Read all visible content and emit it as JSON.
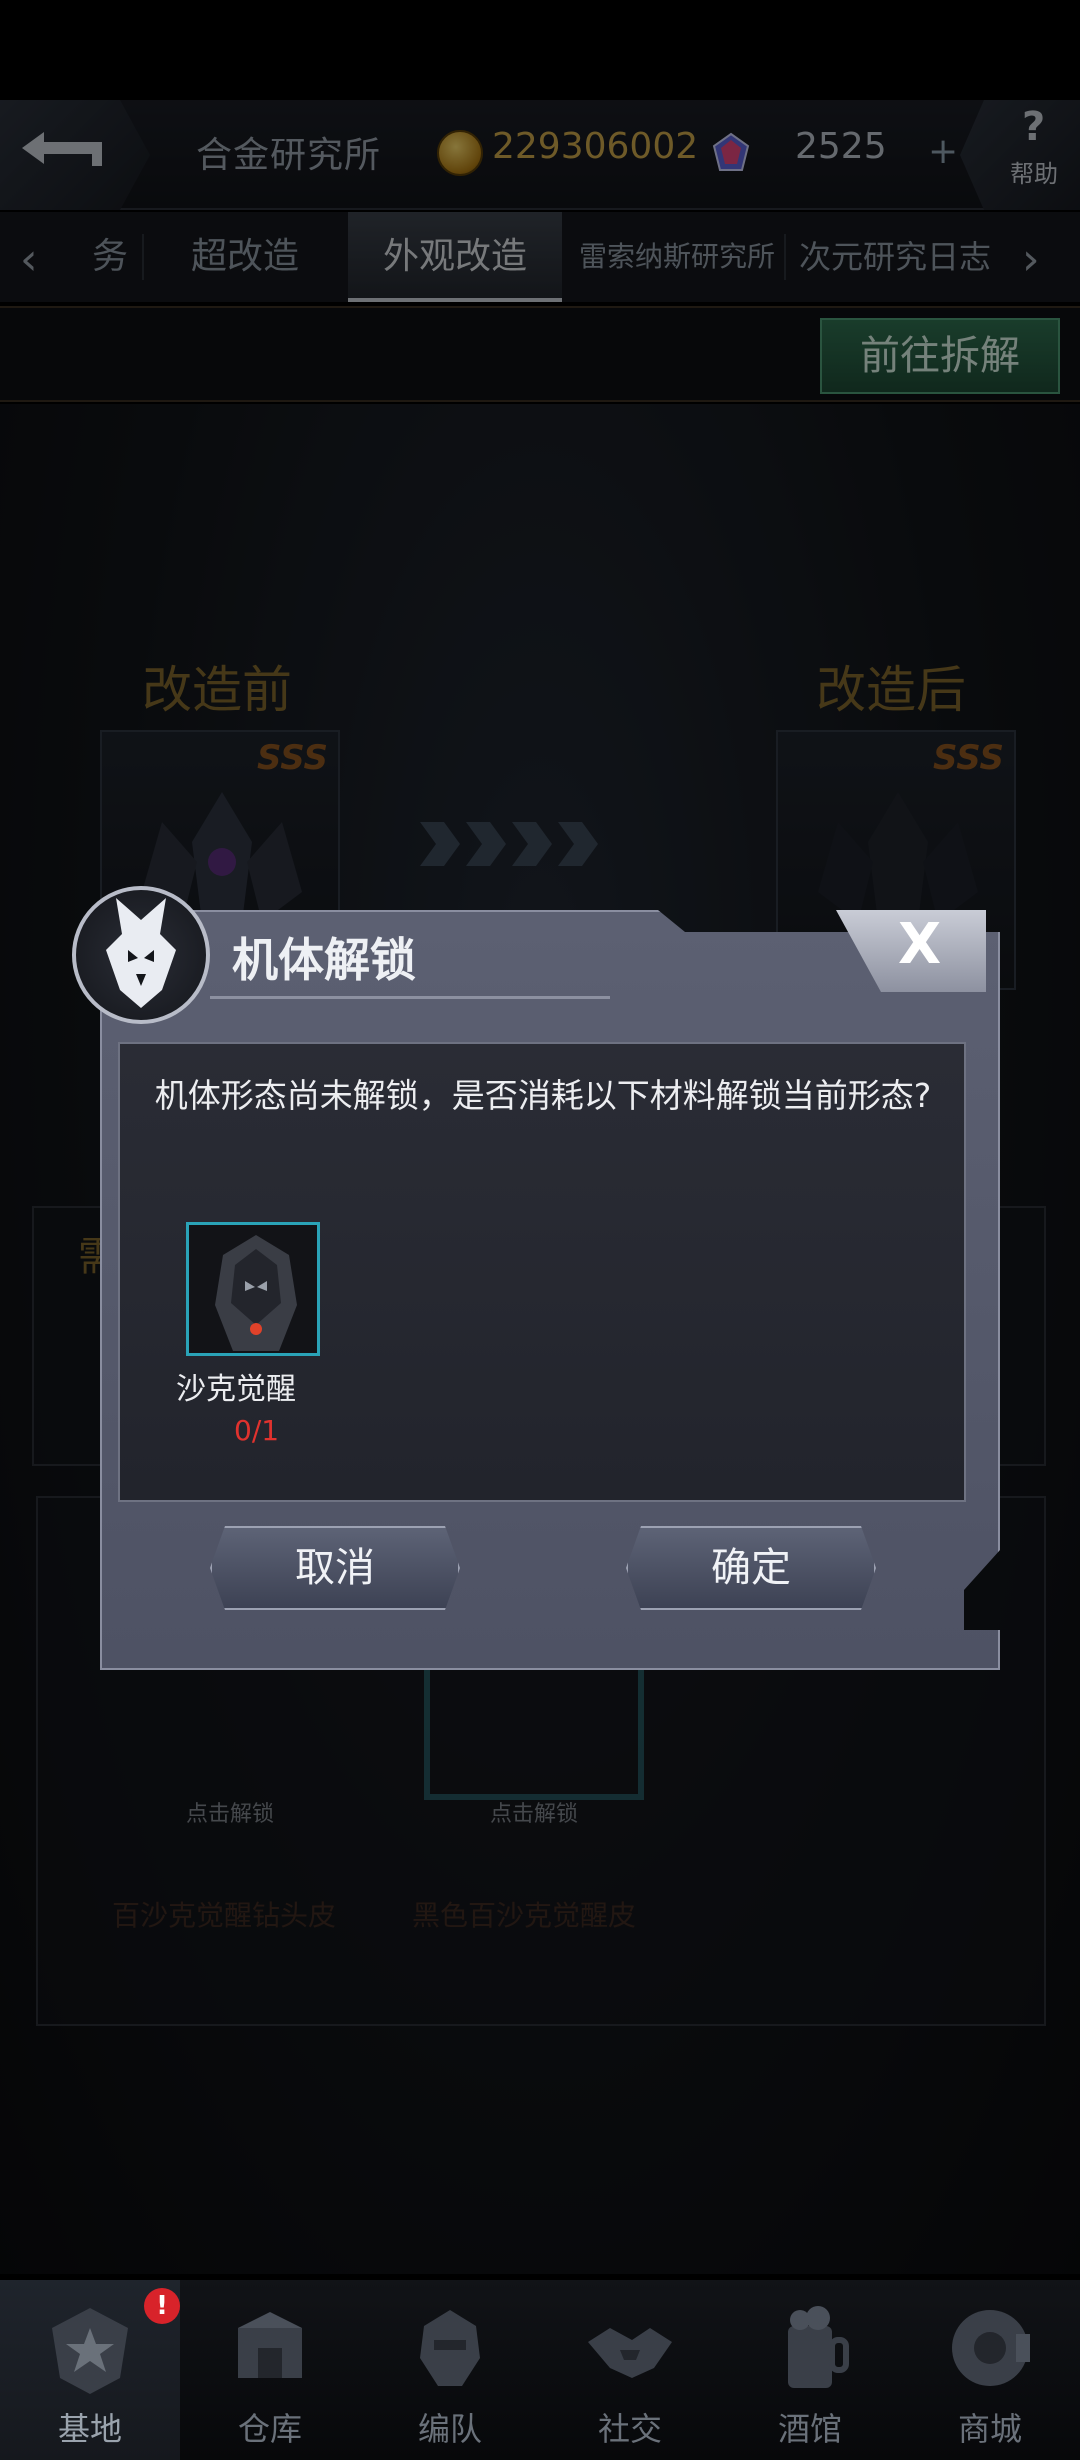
{
  "header": {
    "title": "合金研究所",
    "gold": "229306002",
    "gems": "2525",
    "plus": "+",
    "help_glyph": "?",
    "help_label": "帮助"
  },
  "tabs": [
    {
      "label": "务"
    },
    {
      "label": "超改造"
    },
    {
      "label": "外观改造",
      "active": true
    },
    {
      "label": "雷索纳斯研究所"
    },
    {
      "label": "次元研究日志"
    }
  ],
  "subbar": {
    "go_button": "前往拆解"
  },
  "background": {
    "before_label": "改造前",
    "after_label": "改造后",
    "rank": "SSS",
    "partial_label": "需",
    "tap_unlock_1": "点击解锁",
    "tap_unlock_2": "点击解锁",
    "skin_1": "百沙克觉醒钻头皮",
    "skin_2": "黑色百沙克觉醒皮"
  },
  "dialog": {
    "title": "机体解锁",
    "close_glyph": "X",
    "message": "机体形态尚未解锁，是否消耗以下材料解锁当前形态?",
    "item": {
      "name": "沙克觉醒",
      "count": "0/1"
    },
    "cancel": "取消",
    "confirm": "确定"
  },
  "bottom_nav": [
    {
      "label": "基地",
      "icon": "base-icon",
      "active": true,
      "badge": "!"
    },
    {
      "label": "仓库",
      "icon": "warehouse-icon"
    },
    {
      "label": "编队",
      "icon": "squad-icon"
    },
    {
      "label": "社交",
      "icon": "handshake-icon"
    },
    {
      "label": "酒馆",
      "icon": "tavern-icon"
    },
    {
      "label": "商城",
      "icon": "shop-icon"
    }
  ],
  "colors": {
    "gold_text": "#c9a54a",
    "go_button": "#2f6e4f",
    "count_red": "#e0322e",
    "badge_red": "#d8232a",
    "dialog_panel": "#5c6072"
  }
}
